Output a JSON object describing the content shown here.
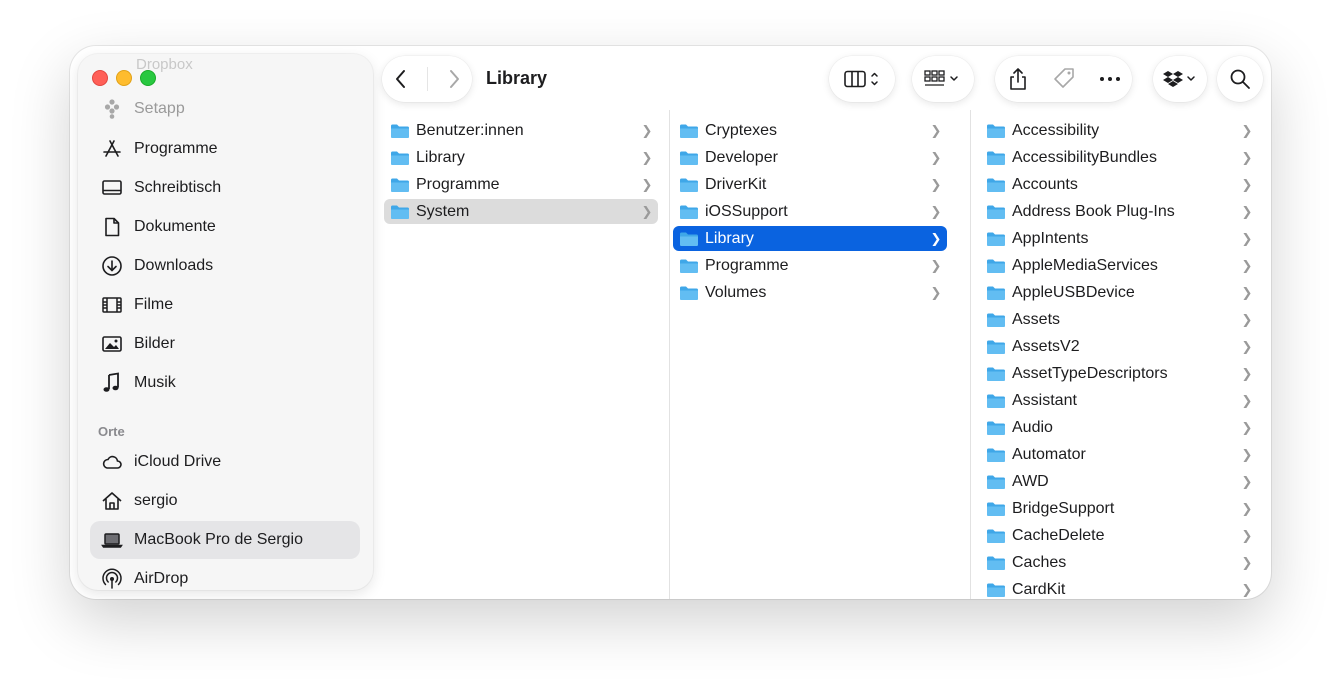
{
  "window": {
    "title": "Library"
  },
  "sidebar": {
    "ghost_items": [
      "Dropbox",
      "Setapp"
    ],
    "favorites": [
      {
        "label": "Programme",
        "icon": "app-store-icon"
      },
      {
        "label": "Schreibtisch",
        "icon": "desktop-icon"
      },
      {
        "label": "Dokumente",
        "icon": "document-icon"
      },
      {
        "label": "Downloads",
        "icon": "download-icon"
      },
      {
        "label": "Filme",
        "icon": "film-icon"
      },
      {
        "label": "Bilder",
        "icon": "photo-icon"
      },
      {
        "label": "Musik",
        "icon": "music-note-icon"
      }
    ],
    "section_title": "Orte",
    "locations": [
      {
        "label": "iCloud Drive",
        "icon": "cloud-icon"
      },
      {
        "label": "sergio",
        "icon": "home-icon"
      },
      {
        "label": "MacBook Pro de Sergio",
        "icon": "laptop-icon",
        "selected": true
      },
      {
        "label": "AirDrop",
        "icon": "airdrop-icon"
      }
    ]
  },
  "toolbar": {
    "back": "chevron-left-icon",
    "forward": "chevron-right-icon",
    "view_mode": "column-view-icon",
    "group": "grid-group-icon",
    "share": "share-icon",
    "tag": "tag-icon",
    "more": "ellipsis-icon",
    "dropbox": "dropbox-icon",
    "search": "search-icon"
  },
  "columns": [
    {
      "items": [
        "Benutzer:innen",
        "Library",
        "Programme",
        "System"
      ],
      "selected": "System",
      "selected_style": "inactive"
    },
    {
      "items": [
        "Cryptexes",
        "Developer",
        "DriverKit",
        "iOSSupport",
        "Library",
        "Programme",
        "Volumes"
      ],
      "selected": "Library",
      "selected_style": "active"
    },
    {
      "items": [
        "Accessibility",
        "AccessibilityBundles",
        "Accounts",
        "Address Book Plug-Ins",
        "AppIntents",
        "AppleMediaServices",
        "AppleUSBDevice",
        "Assets",
        "AssetsV2",
        "AssetTypeDescriptors",
        "Assistant",
        "Audio",
        "Automator",
        "AWD",
        "BridgeSupport",
        "CacheDelete",
        "Caches",
        "CardKit"
      ],
      "selected": null
    }
  ],
  "colors": {
    "accent": "#0a63e0",
    "folder": "#3fa7e8",
    "close": "#ff5f57",
    "minimize": "#febc2e",
    "maximize": "#28c840"
  }
}
